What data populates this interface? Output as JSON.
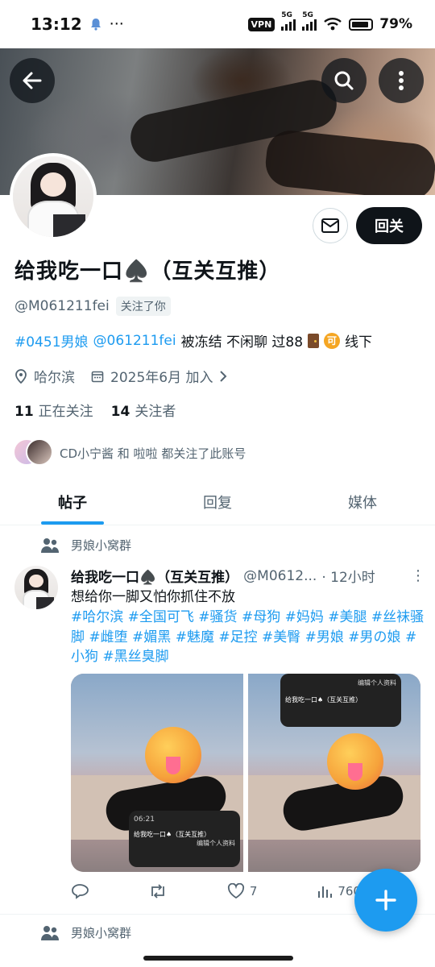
{
  "statusbar": {
    "time": "13:12",
    "dots": "···",
    "vpn": "VPN",
    "net1": "5G",
    "net2": "5G",
    "battery": "79%"
  },
  "profile": {
    "name": "给我吃一口♠️（互关互推）",
    "handle": "@M061211fei",
    "follows_you": "关注了你",
    "follow_button": "回关",
    "bio": {
      "tag1": "#0451男娘",
      "mention": "@061211fei",
      "text1": "被冻结 不闲聊 过88",
      "ke": "可",
      "text2": "线下"
    },
    "location": "哈尔滨",
    "joined": "2025年6月 加入",
    "following_count": "11",
    "following_label": "正在关注",
    "followers_count": "14",
    "followers_label": "关注者",
    "followed_by": "CD小宁酱 和 啦啦 都关注了此账号"
  },
  "tabs": [
    "帖子",
    "回复",
    "媒体"
  ],
  "community_top": "男娘小窝群",
  "post": {
    "name": "给我吃一口♠️（互关互推）",
    "handle": "@M0612...",
    "time": "· 12小时",
    "text": "想给你一脚又怕你抓住不放",
    "tags": "#哈尔滨 #全国可飞 #骚货 #母狗 #妈妈 #美腿 #丝袜骚脚 #雌堕 #媚黑 #魅魔 #足控 #美臀 #男娘 #男の娘 #小狗 #黑丝臭脚",
    "screen1": {
      "time": "06:21",
      "name": "给我吃一口♠（互关互推）",
      "edit": "编辑个人资料"
    },
    "screen2": {
      "name": "给我吃一口♠（互关互推）",
      "edit": "编辑个人资料"
    },
    "likes": "7",
    "views": "760"
  },
  "community_bottom": "男娘小窝群",
  "colors": {
    "accent": "#1d9bf0",
    "text": "#0f1419",
    "muted": "#536471"
  }
}
